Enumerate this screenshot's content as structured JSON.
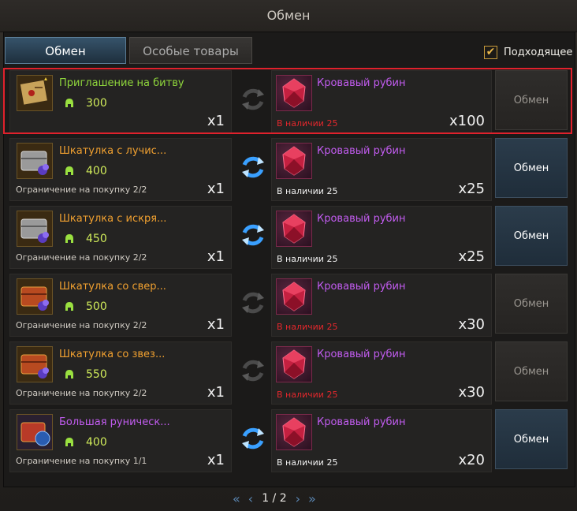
{
  "window": {
    "title": "Обмен"
  },
  "tabs": [
    {
      "label": "Обмен"
    },
    {
      "label": "Особые товары"
    }
  ],
  "filter": {
    "label": "Подходящее",
    "checked": true
  },
  "rows": [
    {
      "item": {
        "name": "Приглашение на битву",
        "name_color": "green",
        "icon": "battle-invitation-icon",
        "cost": "300",
        "limit": "",
        "qty": "x1"
      },
      "reward": {
        "name": "Кровавый рубин",
        "icon": "blood-ruby-icon",
        "stock": "В наличии 25",
        "stock_color": "red",
        "qty": "x100"
      },
      "button": {
        "label": "Обмен",
        "enabled": false
      },
      "selected": true
    },
    {
      "item": {
        "name": "Шкатулка с лучис...",
        "name_color": "orange",
        "icon": "silver-chest-icon",
        "cost": "400",
        "limit": "Ограничение на покупку 2/2",
        "qty": "x1"
      },
      "reward": {
        "name": "Кровавый рубин",
        "icon": "blood-ruby-icon",
        "stock": "В наличии 25",
        "stock_color": "white",
        "qty": "x25"
      },
      "button": {
        "label": "Обмен",
        "enabled": true
      },
      "selected": false
    },
    {
      "item": {
        "name": "Шкатулка с искря...",
        "name_color": "orange",
        "icon": "silver-chest-icon",
        "cost": "450",
        "limit": "Ограничение на покупку 2/2",
        "qty": "x1"
      },
      "reward": {
        "name": "Кровавый рубин",
        "icon": "blood-ruby-icon",
        "stock": "В наличии 25",
        "stock_color": "white",
        "qty": "x25"
      },
      "button": {
        "label": "Обмен",
        "enabled": true
      },
      "selected": false
    },
    {
      "item": {
        "name": "Шкатулка со свер...",
        "name_color": "orange",
        "icon": "red-chest-icon",
        "cost": "500",
        "limit": "Ограничение на покупку 2/2",
        "qty": "x1"
      },
      "reward": {
        "name": "Кровавый рубин",
        "icon": "blood-ruby-icon",
        "stock": "В наличии 25",
        "stock_color": "red",
        "qty": "x30"
      },
      "button": {
        "label": "Обмен",
        "enabled": false
      },
      "selected": false
    },
    {
      "item": {
        "name": "Шкатулка со звез...",
        "name_color": "orange",
        "icon": "red-chest-icon",
        "cost": "550",
        "limit": "Ограничение на покупку 2/2",
        "qty": "x1"
      },
      "reward": {
        "name": "Кровавый рубин",
        "icon": "blood-ruby-icon",
        "stock": "В наличии 25",
        "stock_color": "red",
        "qty": "x30"
      },
      "button": {
        "label": "Обмен",
        "enabled": false
      },
      "selected": false
    },
    {
      "item": {
        "name": "Большая руническ...",
        "name_color": "purple",
        "icon": "rune-chest-icon",
        "cost": "400",
        "limit": "Ограничение на покупку 1/1",
        "qty": "x1"
      },
      "reward": {
        "name": "Кровавый рубин",
        "icon": "blood-ruby-icon",
        "stock": "В наличии 25",
        "stock_color": "white",
        "qty": "x20"
      },
      "button": {
        "label": "Обмен",
        "enabled": true
      },
      "selected": false
    }
  ],
  "pager": {
    "text": "1 / 2"
  },
  "colors": {
    "accent_blue": "#3a8fd8",
    "selected_border": "#e0212c",
    "stock_red": "#e3272c"
  }
}
